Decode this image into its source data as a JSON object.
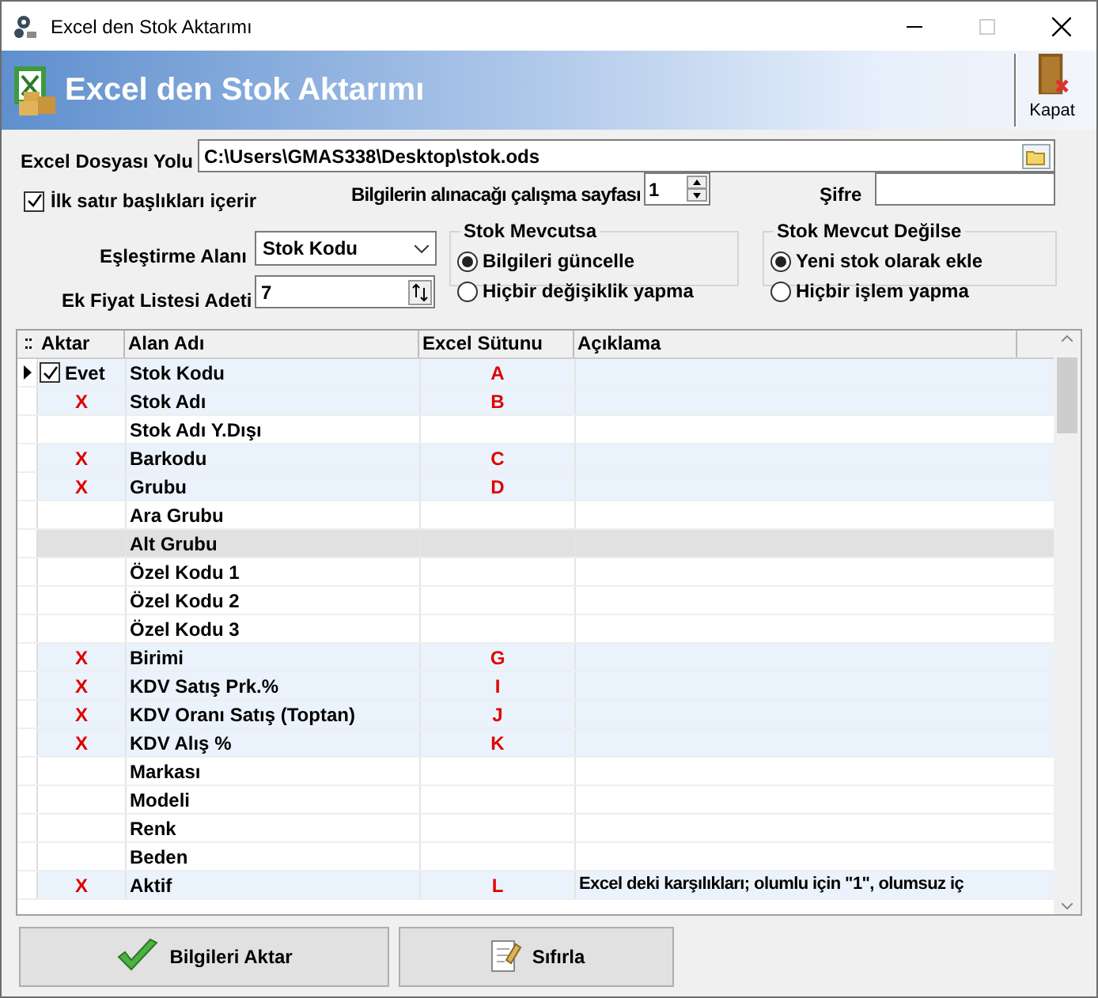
{
  "window": {
    "title": "Excel den Stok Aktarımı"
  },
  "header": {
    "title": "Excel den Stok Aktarımı",
    "close_label": "Kapat"
  },
  "form": {
    "file_label": "Excel Dosyası Yolu",
    "file_value": "C:\\Users\\GMAS338\\Desktop\\stok.ods",
    "header_row": {
      "label": "İlk satır başlıkları içerir",
      "checked": true
    },
    "sheet_label": "Bilgilerin alınacağı çalışma sayfası",
    "sheet_value": "1",
    "password_label": "Şifre",
    "match_label": "Eşleştirme Alanı",
    "match_value": "Stok Kodu",
    "price_label": "Ek Fiyat Listesi Adeti",
    "price_value": "7",
    "groups": [
      {
        "title": "Stok Mevcutsa",
        "options": [
          {
            "label": "Bilgileri güncelle",
            "selected": true
          },
          {
            "label": "Hiçbir değişiklik yapma",
            "selected": false
          }
        ]
      },
      {
        "title": "Stok Mevcut Değilse",
        "options": [
          {
            "label": "Yeni stok olarak ekle",
            "selected": true
          },
          {
            "label": "Hiçbir işlem yapma",
            "selected": false
          }
        ]
      }
    ]
  },
  "table": {
    "columns": [
      "Aktar",
      "Alan Adı",
      "Excel Sütunu",
      "Açıklama"
    ],
    "rows": [
      {
        "kind": "checkbox",
        "aktar": "Evet",
        "checked": true,
        "name": "Stok Kodu",
        "excel": "A",
        "mapped": true,
        "selected": false,
        "current": true
      },
      {
        "kind": "mark",
        "aktar": "X",
        "name": "Stok Adı",
        "excel": "B",
        "mapped": true,
        "selected": false,
        "current": false
      },
      {
        "kind": "empty",
        "name": "Stok Adı Y.Dışı",
        "mapped": false,
        "selected": false,
        "current": false
      },
      {
        "kind": "mark",
        "aktar": "X",
        "name": "Barkodu",
        "excel": "C",
        "mapped": true,
        "selected": false,
        "current": false
      },
      {
        "kind": "mark",
        "aktar": "X",
        "name": "Grubu",
        "excel": "D",
        "mapped": true,
        "selected": false,
        "current": false
      },
      {
        "kind": "empty",
        "name": "Ara Grubu",
        "mapped": false,
        "selected": false,
        "current": false
      },
      {
        "kind": "empty",
        "name": "Alt Grubu",
        "mapped": false,
        "selected": true,
        "current": false
      },
      {
        "kind": "empty",
        "name": "Özel Kodu 1",
        "mapped": false,
        "selected": false,
        "current": false
      },
      {
        "kind": "empty",
        "name": "Özel Kodu 2",
        "mapped": false,
        "selected": false,
        "current": false
      },
      {
        "kind": "empty",
        "name": "Özel Kodu 3",
        "mapped": false,
        "selected": false,
        "current": false
      },
      {
        "kind": "mark",
        "aktar": "X",
        "name": "Birimi",
        "excel": "G",
        "mapped": true,
        "selected": false,
        "current": false
      },
      {
        "kind": "mark",
        "aktar": "X",
        "name": "KDV Satış Prk.%",
        "excel": "I",
        "mapped": true,
        "selected": false,
        "current": false
      },
      {
        "kind": "mark",
        "aktar": "X",
        "name": "KDV Oranı Satış (Toptan)",
        "excel": "J",
        "mapped": true,
        "selected": false,
        "current": false
      },
      {
        "kind": "mark",
        "aktar": "X",
        "name": "KDV Alış %",
        "excel": "K",
        "mapped": true,
        "selected": false,
        "current": false
      },
      {
        "kind": "empty",
        "name": "Markası",
        "mapped": false,
        "selected": false,
        "current": false
      },
      {
        "kind": "empty",
        "name": "Modeli",
        "mapped": false,
        "selected": false,
        "current": false
      },
      {
        "kind": "empty",
        "name": "Renk",
        "mapped": false,
        "selected": false,
        "current": false
      },
      {
        "kind": "empty",
        "name": "Beden",
        "mapped": false,
        "selected": false,
        "current": false
      },
      {
        "kind": "mark",
        "aktar": "X",
        "name": "Aktif",
        "excel": "L",
        "description": "Excel deki karşılıkları; olumlu için \"1\", olumsuz iç",
        "mapped": true,
        "selected": false,
        "current": false
      }
    ]
  },
  "buttons": [
    {
      "kind": "transfer",
      "label": "Bilgileri Aktar"
    },
    {
      "kind": "reset",
      "label": "Sıfırla"
    }
  ]
}
